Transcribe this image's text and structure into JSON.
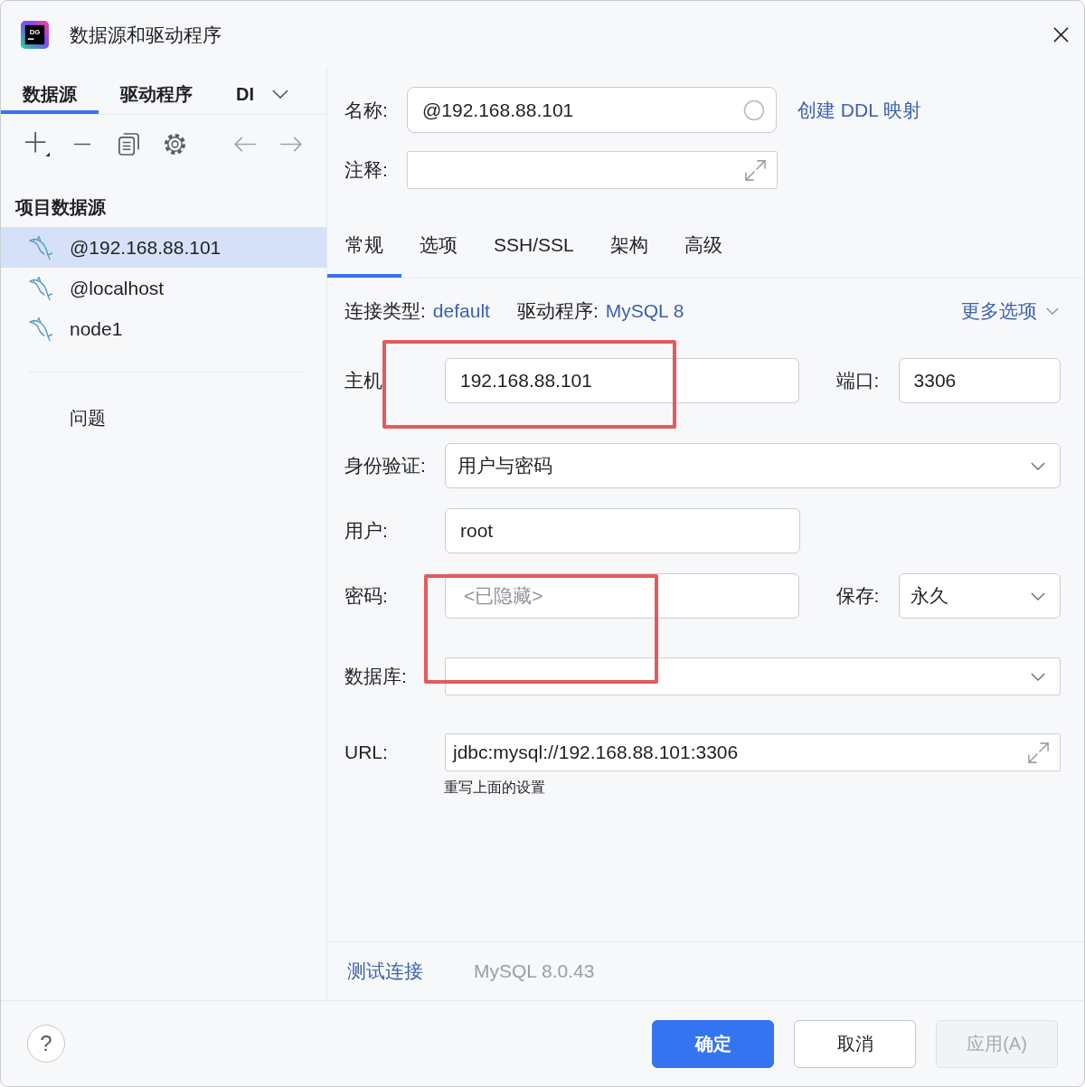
{
  "window": {
    "title": "数据源和驱动程序",
    "logo_text": "DG"
  },
  "sidebar": {
    "tabs": [
      {
        "label": "数据源",
        "selected": true
      },
      {
        "label": "驱动程序",
        "selected": false
      },
      {
        "label": "DI",
        "selected": false
      }
    ],
    "section_title": "项目数据源",
    "items": [
      {
        "label": "@192.168.88.101",
        "selected": true
      },
      {
        "label": "@localhost",
        "selected": false
      },
      {
        "label": "node1",
        "selected": false
      }
    ],
    "problems": "问题"
  },
  "header": {
    "name_label": "名称:",
    "name_value": "@192.168.88.101",
    "ddl_link": "创建 DDL 映射",
    "comment_label": "注释:"
  },
  "tabs": [
    {
      "label": "常规",
      "selected": true
    },
    {
      "label": "选项",
      "selected": false
    },
    {
      "label": "SSH/SSL",
      "selected": false
    },
    {
      "label": "架构",
      "selected": false
    },
    {
      "label": "高级",
      "selected": false
    }
  ],
  "connection": {
    "type_label": "连接类型:",
    "type": "default",
    "driver_label": "驱动程序:",
    "driver": "MySQL 8",
    "more_options": "更多选项"
  },
  "form": [
    {
      "kind": "text",
      "label": "主机",
      "value": "192.168.88.101",
      "highlighted": true,
      "side": {
        "label": "端口:",
        "kind": "text",
        "value": "3306"
      }
    },
    {
      "kind": "select",
      "label": "身份验证:",
      "value": "用户与密码",
      "highlighted": false
    },
    {
      "kind": "text",
      "label": "用户:",
      "value": "root",
      "highlighted": false
    },
    {
      "kind": "password",
      "label": "密码:",
      "placeholder": "<已隐藏>",
      "highlighted": true,
      "side": {
        "label": "保存:",
        "kind": "select",
        "value": "永久"
      }
    },
    {
      "kind": "combo",
      "label": "数据库:",
      "highlighted": false
    },
    {
      "kind": "url",
      "label": "URL:",
      "value": "jdbc:mysql://192.168.88.101:3306",
      "hint": "重写上面的设置",
      "highlighted": false
    }
  ],
  "status": {
    "test_connection": "测试连接",
    "server_version": "MySQL 8.0.43"
  },
  "footer": {
    "help": "?",
    "buttons": [
      {
        "label": "确定",
        "kind": "primary",
        "disabled": false
      },
      {
        "label": "取消",
        "kind": "secondary",
        "disabled": false
      },
      {
        "label": "应用(A)",
        "kind": "secondary",
        "disabled": true
      }
    ]
  }
}
